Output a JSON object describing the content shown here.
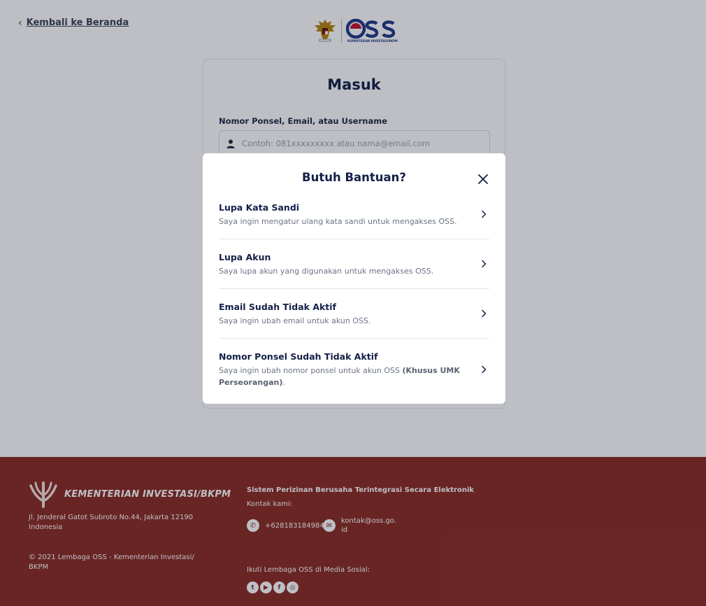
{
  "back_link": {
    "label": "Kembali ke Beranda"
  },
  "logo": {
    "name": "OSS",
    "tagline": "KEMENTERIAN INVESTASI/BKPM"
  },
  "login": {
    "title": "Masuk",
    "field_label": "Nomor Ponsel, Email, atau Username",
    "field_placeholder": "Contoh: 081xxxxxxxxx atau nama@email.com"
  },
  "modal": {
    "title": "Butuh Bantuan?",
    "items": [
      {
        "title": "Lupa Kata Sandi",
        "desc": "Saya ingin mengatur ulang kata sandi untuk mengakses OSS."
      },
      {
        "title": "Lupa Akun",
        "desc": "Saya lupa akun yang digunakan untuk mengakses OSS."
      },
      {
        "title": "Email Sudah Tidak Aktif",
        "desc": "Saya ingin ubah email untuk akun OSS."
      },
      {
        "title": "Nomor Ponsel Sudah Tidak Aktif",
        "desc_prefix": "Saya ingin ubah nomor ponsel untuk akun OSS ",
        "desc_bold": "(Khusus UMK Perseorangan)",
        "desc_suffix": "."
      }
    ]
  },
  "footer": {
    "brand": "KEMENTERIAN INVESTASI/BKPM",
    "address": "Jl. Jenderal Gatot Subroto No.44, Jakarta 12190 Indonesia",
    "copyright": "© 2021 Lembaga OSS - Kementerian Investasi/ BKPM",
    "system_name": "Sistem Perizinan Berusaha Terintegrasi Secara Elektronik",
    "contact_label": "Kontak kami:",
    "phone": "+628183184984",
    "email": "kontak@oss.go.id",
    "social_label": "Ikuti Lembaga OSS di Media Sosial:",
    "social": [
      "twitter-icon",
      "youtube-icon",
      "facebook-icon",
      "instagram-icon"
    ]
  },
  "colors": {
    "footer_bg": "#8c2d22",
    "brand_navy": "#142048",
    "oss_blue": "#223a86",
    "overlay": "rgba(12,18,40,0.27)"
  }
}
